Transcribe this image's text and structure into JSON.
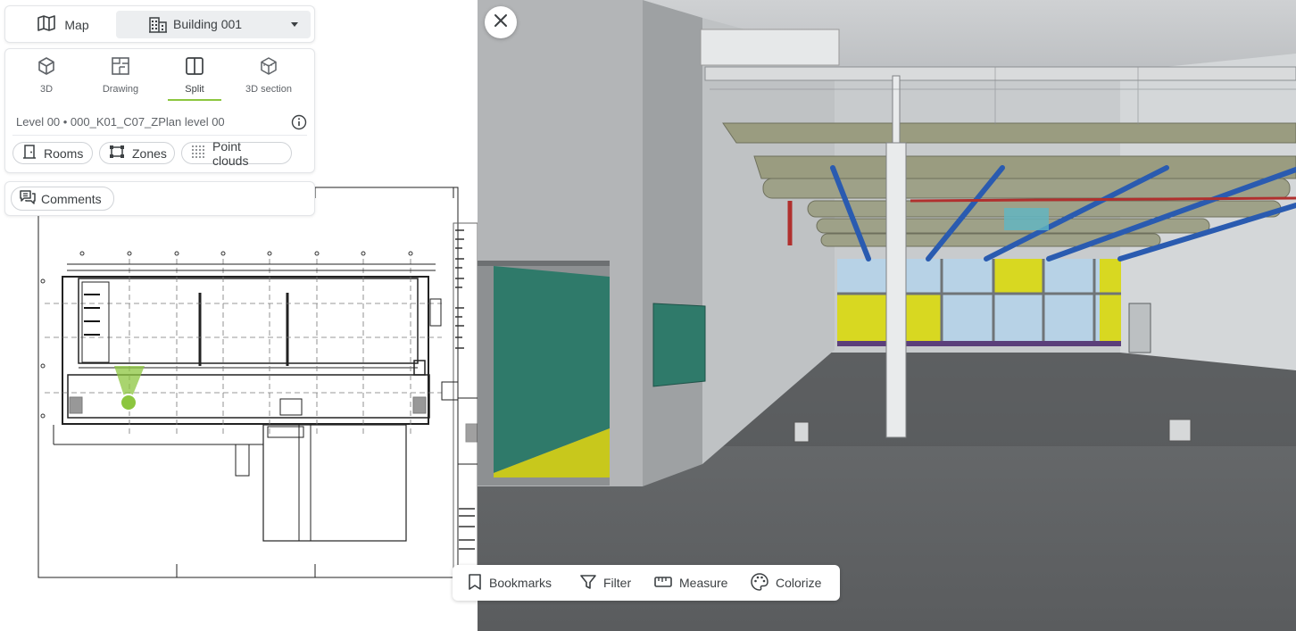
{
  "header": {
    "map_label": "Map",
    "building_label": "Building 001"
  },
  "view_modes": [
    {
      "label": "3D",
      "icon": "cube-icon"
    },
    {
      "label": "Drawing",
      "icon": "floorplan-icon"
    },
    {
      "label": "Split",
      "icon": "split-view-icon",
      "active": true
    },
    {
      "label": "3D section",
      "icon": "cube-section-icon"
    }
  ],
  "level": {
    "text": "Level 00 • 000_K01_C07_ZPlan level 00"
  },
  "layers": {
    "rooms_label": "Rooms",
    "zones_label": "Zones",
    "point_clouds_label": "Point clouds"
  },
  "comments": {
    "label": "Comments"
  },
  "toolbar": {
    "bookmarks_label": "Bookmarks",
    "filter_label": "Filter",
    "measure_label": "Measure",
    "colorize_label": "Colorize"
  },
  "colors": {
    "accent": "#8cc63f",
    "chip_border": "#d0d3d7",
    "text": "#3c4043"
  }
}
